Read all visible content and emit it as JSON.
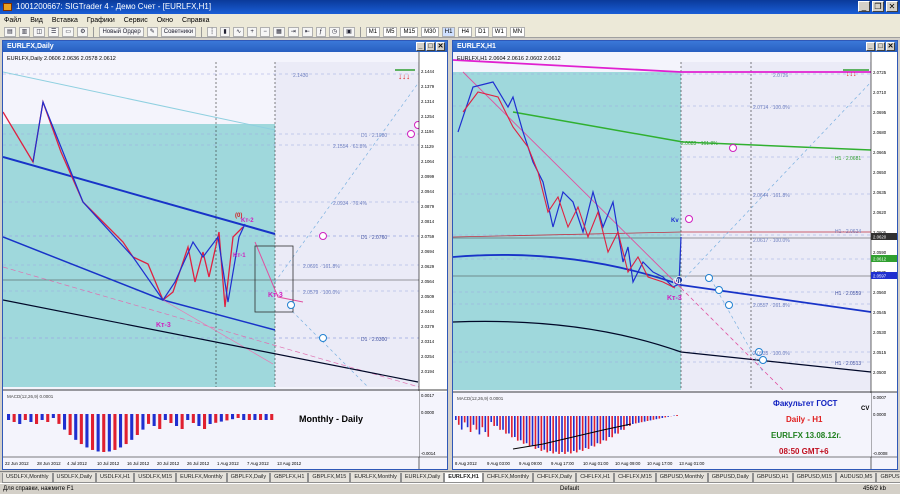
{
  "app": {
    "title": "1001200667: SIGTrader 4 - Демо Счет - [EURLFX,H1]",
    "menu": [
      "Файл",
      "Вид",
      "Вставка",
      "Графики",
      "Сервис",
      "Окно",
      "Справка"
    ],
    "toolbar": {
      "new_order": "Новый Ордер",
      "advisors": "Советники",
      "timeframes": [
        "M1",
        "M5",
        "M15",
        "M30",
        "H1",
        "H4",
        "D1",
        "W1",
        "MN"
      ]
    }
  },
  "colors": {
    "accent": "#1a5ed6",
    "window_bg": "#f4f4fc",
    "shade": "#9fd8dc",
    "bull": "#1f2fd0",
    "bear": "#e02030",
    "magenta": "#e020d0"
  },
  "left_chart": {
    "window_title": "EURLFX,Daily",
    "header": "EURLFX,Daily  2.0606 2.0636 2.0578 2.0612",
    "price_scale": [
      "2.1444",
      "2.1379",
      "2.1314",
      "2.1254",
      "2.1194",
      "2.1129",
      "2.1064",
      "2.0999",
      "2.0944",
      "2.0879",
      "2.0814",
      "2.0759",
      "2.0694",
      "2.0629",
      "2.0564",
      "2.0509",
      "2.0444",
      "2.0379",
      "2.0314",
      "2.0254",
      "2.0194"
    ],
    "level_labels": [
      "2.1430",
      "2.1554 · 61.8%",
      "D1 · 2.1080",
      "2.0934 · 76.4%",
      "D1 · 2.0760",
      "2.0691 · 161.8%",
      "2.0579 · 100.0%",
      "D1 · 2.0300"
    ],
    "wave_labels": {
      "kt3_low": "Kт-3",
      "kt1": "Kт-1",
      "kt2": "Kт-2",
      "kt3_right": "Kт-3",
      "zero": "(0)"
    },
    "indicator_scale": [
      "0.0017",
      "0.0000",
      "-0.0014"
    ],
    "indicator_label": "MACD(12,26,9) 0.0001",
    "caption": "Monthly - Daily",
    "dates": [
      "22 Jun 2012",
      "28 Jun 2012",
      "4 Jul 2012",
      "10 Jul 2012",
      "16 Jul 2012",
      "20 Jul 2012",
      "26 Jul 2012",
      "1 Aug 2012",
      "7 Aug 2012",
      "13 Aug 2012"
    ]
  },
  "right_chart": {
    "window_title": "EURLFX,H1",
    "header": "EURLFX,H1  2.0604 2.0616 2.0602 2.0612",
    "price_scale": [
      "2.0725",
      "2.0710",
      "2.0695",
      "2.0680",
      "2.0665",
      "2.0650",
      "2.0635",
      "2.0620",
      "2.0605",
      "2.0590",
      "2.0575",
      "2.0560",
      "2.0545",
      "2.0530",
      "2.0515",
      "2.0500"
    ],
    "level_labels": [
      "2.0726",
      "2.0714 · 100.0%",
      "2.0683 · 161.8%",
      "H1 · 2.0681",
      "2.0644 · 161.8%",
      "H1 · 2.0624",
      "2.0617 · 100.0%",
      "H1 · 2.0559",
      "2.0557 · 261.8%",
      "2.0535 · 100.0%",
      "H1 · 2.0513"
    ],
    "tags": {
      "price1": "2.0620",
      "price2": "2.0612",
      "price3": "2.0597"
    },
    "wave_labels": {
      "kv": "Kv",
      "zero": "(0)",
      "kt3": "Kт-3"
    },
    "indicator_scale": [
      "0.0007",
      "0.0000",
      "-0.0008"
    ],
    "indicator_label": "MACD(12,26,9) 0.0001",
    "brand": {
      "line1": "Факультет ГОСТ",
      "line2": "Daily - H1",
      "line3": "EURLFX 13.08.12г.",
      "line4": "08:50 GMT+6"
    },
    "cv": "CV",
    "dates": [
      "8 Aug 2012",
      "9 Aug 03:00",
      "9 Aug 09:00",
      "9 Aug 17:00",
      "10 Aug 01:00",
      "10 Aug 09:00",
      "10 Aug 17:00",
      "13 Aug 01:00"
    ]
  },
  "tabs": [
    "USDLFX,Monthly",
    "USDLFX,Daily",
    "USDLFX,H1",
    "USDLFX,M15",
    "EURLFX,Monthly",
    "GBPLFX,Daily",
    "GBPLFX,H1",
    "GBPLFX,M15",
    "EURLFX,Monthly",
    "EURLFX,Daily",
    "EURLFX,H1",
    "CHFLFX,Monthly",
    "CHFLFX,Daily",
    "CHFLFX,H1",
    "CHFLFX,M15",
    "GBPUSD,Monthly",
    "GBPUSD,Daily",
    "GBPUSD,H1",
    "GBPUSD,M15",
    "AUDUSD,M5",
    "GBPUSD,H4"
  ],
  "active_tab": 10,
  "status": {
    "help": "Для справки, нажмите F1",
    "profile": "Default",
    "traffic": "456/2 kb"
  }
}
